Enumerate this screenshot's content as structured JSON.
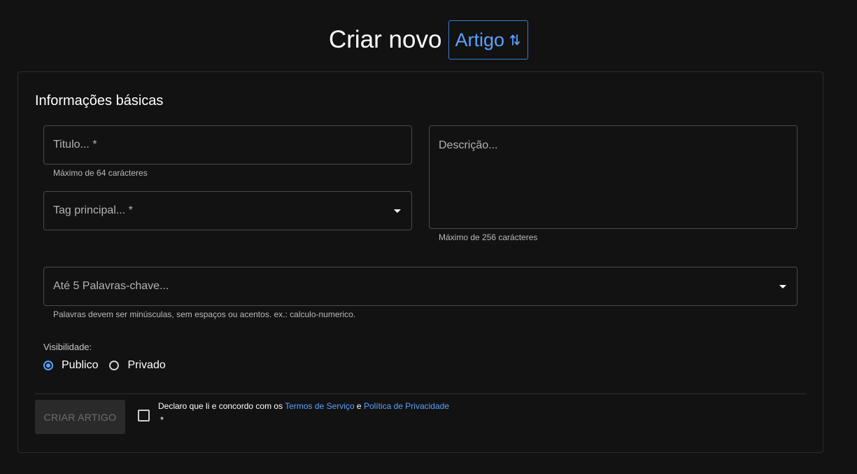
{
  "header": {
    "title": "Criar novo",
    "type_toggle_label": "Artigo",
    "type_toggle_icon": "swap-vertical-icon"
  },
  "form": {
    "section_title": "Informações básicas",
    "title_field": {
      "placeholder": "Titulo... *",
      "value": "",
      "helper": "Máximo de 64 carácteres"
    },
    "tag_field": {
      "placeholder": "Tag principal... *",
      "value": ""
    },
    "description_field": {
      "placeholder": "Descrição...",
      "value": "",
      "helper": "Máximo de 256 carácteres"
    },
    "keywords_field": {
      "placeholder": "Até 5 Palavras-chave...",
      "value": "",
      "helper": "Palavras devem ser minúsculas, sem espaços ou acentos. ex.: calculo-numerico."
    },
    "visibility": {
      "label": "Visibilidade:",
      "options": [
        {
          "label": "Publico",
          "selected": true
        },
        {
          "label": "Privado",
          "selected": false
        }
      ]
    },
    "submit_label": "CRIAR ARTIGO",
    "agreement": {
      "prefix": "Declaro que li e concordo com os ",
      "terms_link": "Termos de Serviço",
      "conjunction": " e ",
      "privacy_link": "Política de Privacidade",
      "required_mark": "*",
      "checked": false
    }
  },
  "colors": {
    "background": "#121212",
    "accent": "#5aa2ff",
    "border": "#4a4a4a"
  }
}
